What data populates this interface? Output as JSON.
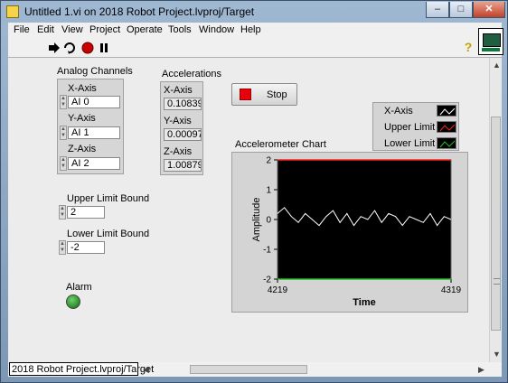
{
  "window": {
    "title": "Untitled 1.vi on 2018 Robot Project.lvproj/Target",
    "controls": {
      "minimize": "–",
      "maximize": "□",
      "close": "✕"
    }
  },
  "menu": [
    "File",
    "Edit",
    "View",
    "Project",
    "Operate",
    "Tools",
    "Window",
    "Help"
  ],
  "toolbar": {
    "run_icon": "run-arrow-icon",
    "continuous_icon": "run-continuously-icon",
    "abort_icon": "abort-icon",
    "pause_icon": "pause-icon",
    "help_icon": "context-help-icon"
  },
  "analog_channels": {
    "label": "Analog Channels",
    "x_label": "X-Axis",
    "x_value": "AI 0",
    "y_label": "Y-Axis",
    "y_value": "AI 1",
    "z_label": "Z-Axis",
    "z_value": "AI 2"
  },
  "accelerations": {
    "label": "Accelerations",
    "x_label": "X-Axis",
    "x_value": "0.108398",
    "y_label": "Y-Axis",
    "y_value": "0.000976",
    "z_label": "Z-Axis",
    "z_value": "1.00879"
  },
  "stop": {
    "label": "Stop",
    "color": "#e8000c"
  },
  "upper_limit": {
    "label": "Upper Limit Bound",
    "value": "2"
  },
  "lower_limit": {
    "label": "Lower Limit Bound",
    "value": "-2"
  },
  "alarm": {
    "label": "Alarm",
    "state": "on",
    "color": "#1a8a1a"
  },
  "status_bar": {
    "path": "2018 Robot Project.lvproj/Target"
  },
  "chart_data": {
    "type": "line",
    "title": "Accelerometer Chart",
    "xlabel": "Time",
    "ylabel": "Amplitude",
    "xlim": [
      4219,
      4319
    ],
    "ylim": [
      -2,
      2
    ],
    "x_ticks": [
      "4219",
      "4319"
    ],
    "y_ticks": [
      "2",
      "1",
      "0",
      "-1",
      "-2"
    ],
    "legend": [
      "X-Axis",
      "Upper Limit",
      "Lower Limit"
    ],
    "legend_position": "top-right",
    "series": [
      {
        "name": "X-Axis",
        "color": "#ffffff",
        "x": [
          4219,
          4223,
          4227,
          4231,
          4235,
          4239,
          4243,
          4247,
          4251,
          4255,
          4259,
          4263,
          4267,
          4271,
          4275,
          4279,
          4283,
          4287,
          4291,
          4295,
          4299,
          4303,
          4307,
          4311,
          4315,
          4319
        ],
        "values": [
          0.2,
          0.4,
          0.1,
          -0.1,
          0.2,
          0.0,
          -0.2,
          0.1,
          0.3,
          -0.1,
          0.2,
          -0.2,
          0.1,
          0.0,
          0.3,
          -0.1,
          0.2,
          0.1,
          -0.2,
          0.1,
          0.0,
          -0.1,
          0.2,
          -0.2,
          0.1,
          0.0
        ]
      },
      {
        "name": "Upper Limit",
        "color": "#ff2020",
        "x": [
          4219,
          4319
        ],
        "values": [
          2,
          2
        ]
      },
      {
        "name": "Lower Limit",
        "color": "#20c020",
        "x": [
          4219,
          4319
        ],
        "values": [
          -2,
          -2
        ]
      }
    ]
  }
}
